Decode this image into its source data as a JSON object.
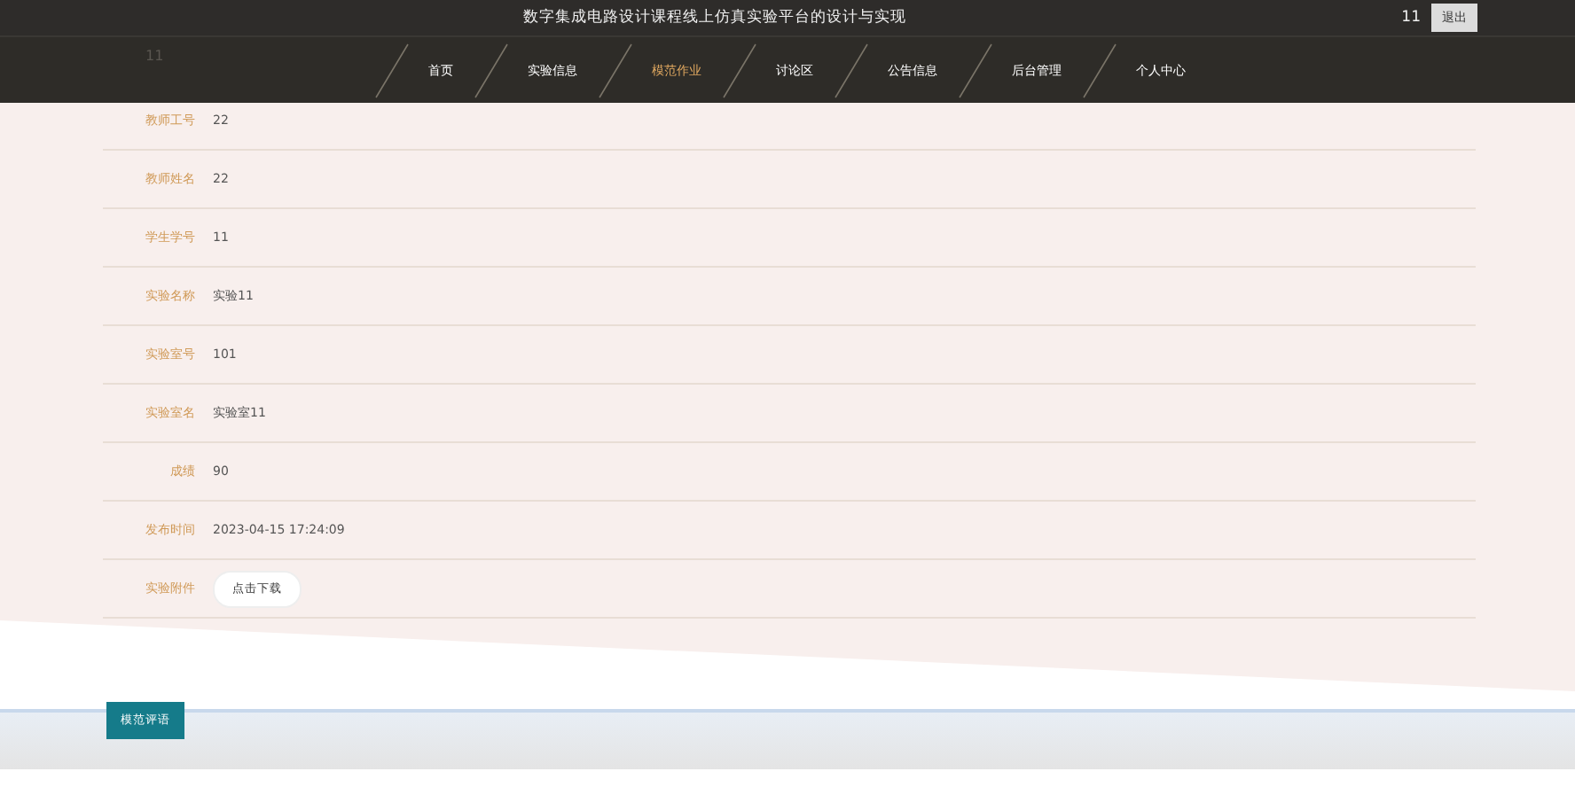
{
  "header": {
    "title": "数字集成电路设计课程线上仿真实验平台的设计与实现",
    "user": "11",
    "logout": "退出"
  },
  "nav": [
    {
      "label": "首页",
      "selected": false
    },
    {
      "label": "实验信息",
      "selected": false
    },
    {
      "label": "模范作业",
      "selected": true
    },
    {
      "label": "讨论区",
      "selected": false
    },
    {
      "label": "公告信息",
      "selected": false
    },
    {
      "label": "后台管理",
      "selected": false
    },
    {
      "label": "个人中心",
      "selected": false
    }
  ],
  "hidden_value": "11",
  "details": [
    {
      "label": "教师工号",
      "value": "22",
      "kind": "text"
    },
    {
      "label": "教师姓名",
      "value": "22",
      "kind": "text"
    },
    {
      "label": "学生学号",
      "value": "11",
      "kind": "text"
    },
    {
      "label": "实验名称",
      "value": "实验11",
      "kind": "text"
    },
    {
      "label": "实验室号",
      "value": "101",
      "kind": "text"
    },
    {
      "label": "实验室名",
      "value": "实验室11",
      "kind": "text"
    },
    {
      "label": "成绩",
      "value": "90",
      "kind": "text"
    },
    {
      "label": "发布时间",
      "value": "2023-04-15 17:24:09",
      "kind": "text"
    },
    {
      "label": "实验附件",
      "value": "点击下载",
      "kind": "button"
    }
  ],
  "comment_tab": "模范评语"
}
